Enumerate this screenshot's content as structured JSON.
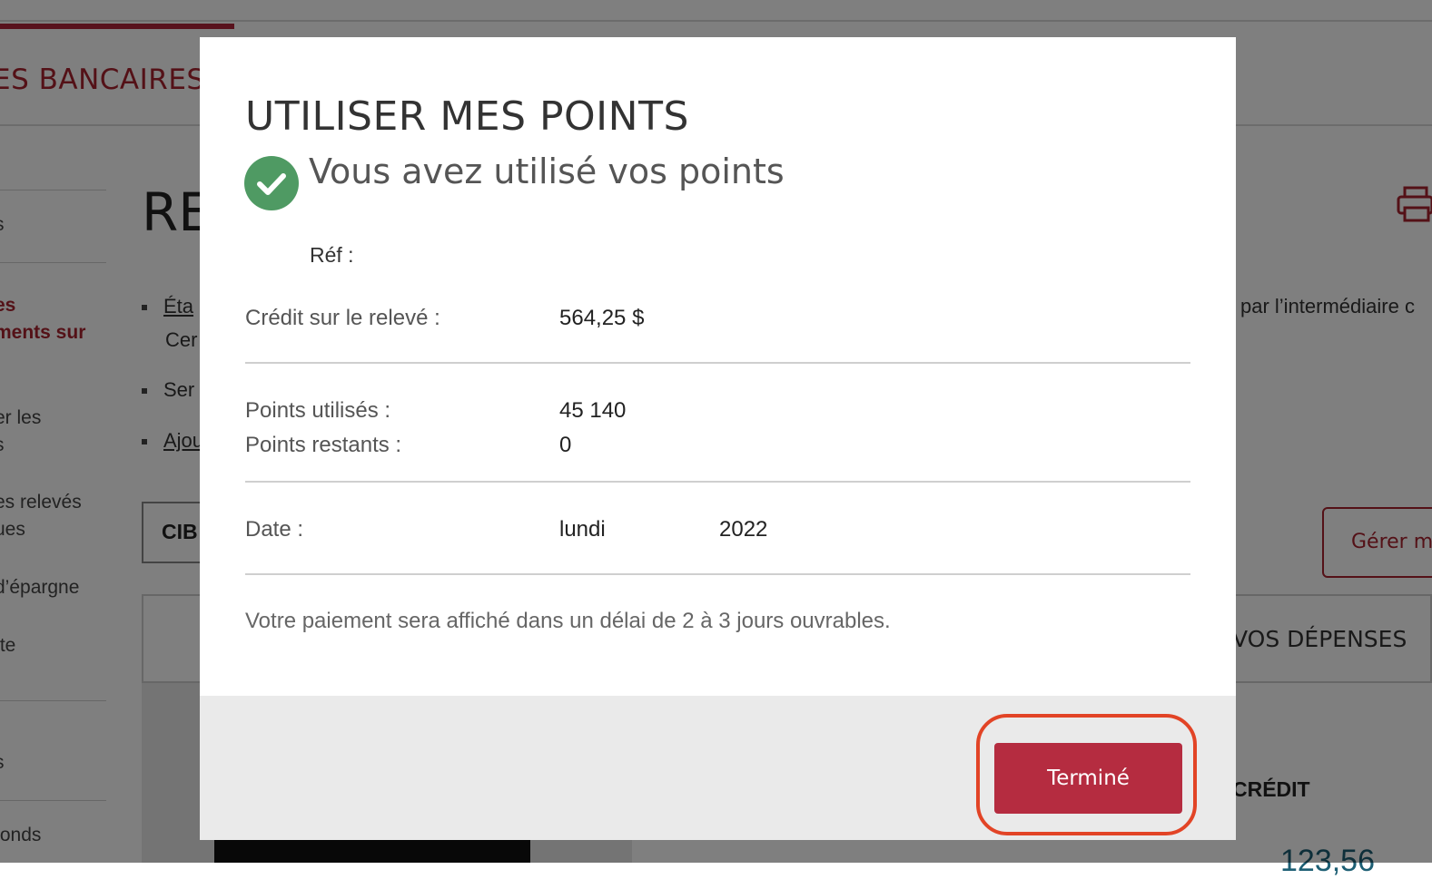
{
  "background": {
    "section_title": "ES BANCAIRES",
    "sidebar": [
      {
        "label": "s",
        "active": false
      },
      {
        "label": "es",
        "active": true
      },
      {
        "label": "ments sur",
        "active": true
      },
      {
        "label": "er les",
        "active": false
      },
      {
        "label": "s",
        "active": false
      },
      {
        "label": "es relevés",
        "active": false
      },
      {
        "label": "ues",
        "active": false
      },
      {
        "label": "d’épargne",
        "active": false
      },
      {
        "label": "tte",
        "active": false
      },
      {
        "label": "s",
        "active": false
      },
      {
        "label": "fonds",
        "active": false
      }
    ],
    "heading": "RE",
    "bullets": [
      {
        "text": "Éta",
        "link": true
      },
      {
        "text": "Ser",
        "link": false
      },
      {
        "text": "Ajou",
        "link": true
      }
    ],
    "bullet_continuation": "Cer",
    "cib_label": "CIB",
    "right_text": "par l’intermédiaire c",
    "manage_button": "Gérer m",
    "depenses_label": "VOS DÉPENSES",
    "credit_label": "CRÉDIT",
    "teal_number": "123,56",
    "icons": {
      "print": "print-icon"
    }
  },
  "modal": {
    "title": "UTILISER MES POINTS",
    "success_message": "Vous avez utilisé vos points",
    "success_icon": "check-circle-icon",
    "ref_label": "Réf :",
    "credit_label": "Crédit sur le relevé :",
    "credit_value": "564,25 $",
    "points_used_label": "Points utilisés :",
    "points_used_value": "45 140",
    "points_remaining_label": "Points restants :",
    "points_remaining_value": "0",
    "date_label": "Date :",
    "date_day": "lundi",
    "date_year": "2022",
    "note": "Votre paiement sera affiché dans un délai de 2 à 3 jours ouvrables.",
    "done_button": "Terminé"
  },
  "colors": {
    "brand_red": "#b52c40",
    "success_green": "#4f9a63",
    "highlight": "#e24426"
  }
}
